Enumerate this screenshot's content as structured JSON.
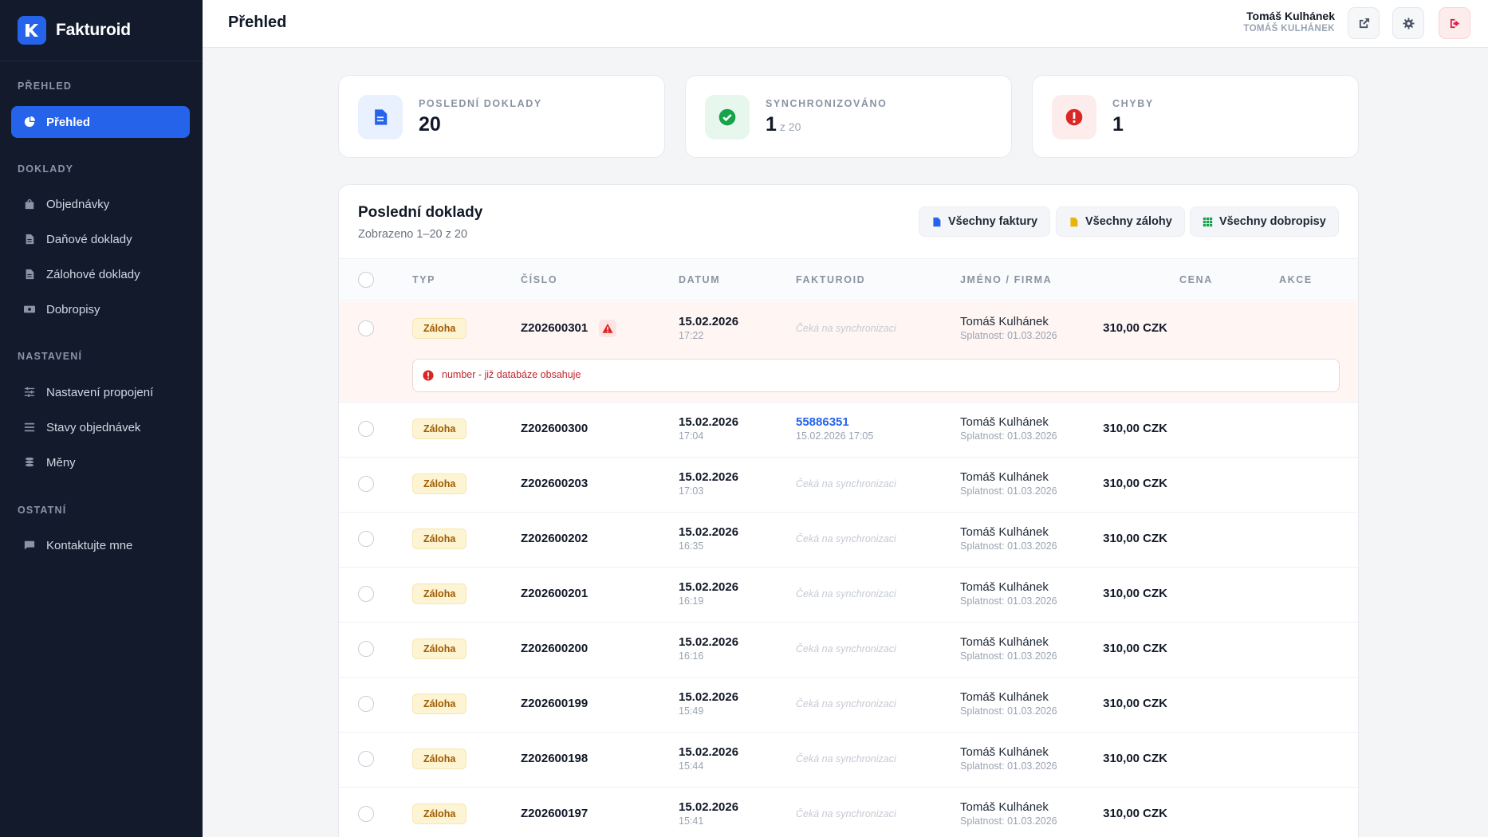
{
  "app": {
    "name": "Fakturoid"
  },
  "sidebar": {
    "sections": [
      {
        "title": "PŘEHLED",
        "items": [
          {
            "label": "Přehled",
            "icon": "pie-chart-icon",
            "active": true
          }
        ]
      },
      {
        "title": "DOKLADY",
        "items": [
          {
            "label": "Objednávky",
            "icon": "shopping-bag-icon"
          },
          {
            "label": "Daňové doklady",
            "icon": "document-icon"
          },
          {
            "label": "Zálohové doklady",
            "icon": "document-icon"
          },
          {
            "label": "Dobropisy",
            "icon": "money-bill-icon"
          }
        ]
      },
      {
        "title": "NASTAVENÍ",
        "items": [
          {
            "label": "Nastavení propojení",
            "icon": "sliders-icon"
          },
          {
            "label": "Stavy objednávek",
            "icon": "list-icon"
          },
          {
            "label": "Měny",
            "icon": "coins-icon"
          }
        ]
      },
      {
        "title": "OSTATNÍ",
        "items": [
          {
            "label": "Kontaktujte mne",
            "icon": "message-icon"
          }
        ]
      }
    ]
  },
  "header": {
    "title": "Přehled",
    "user_name": "Tomáš Kulhánek",
    "user_sub": "TOMÁŠ KULHÁNEK"
  },
  "stats": [
    {
      "label": "POSLEDNÍ DOKLADY",
      "value": "20",
      "sub": "",
      "icon": "document-icon",
      "color": "#2563eb"
    },
    {
      "label": "SYNCHRONIZOVÁNO",
      "value": "1",
      "sub": "z 20",
      "icon": "check-circle-icon",
      "color": "#16a34a"
    },
    {
      "label": "CHYBY",
      "value": "1",
      "sub": "",
      "icon": "alert-circle-icon",
      "color": "#dc2626"
    }
  ],
  "panel": {
    "title": "Poslední doklady",
    "subtitle": "Zobrazeno 1–20 z 20",
    "buttons": {
      "invoices": "Všechny faktury",
      "deposits": "Všechny zálohy",
      "credit_notes": "Všechny dobropisy"
    },
    "columns": {
      "type": "TYP",
      "number": "ČÍSLO",
      "date": "DATUM",
      "fakturoid": "FAKTUROID",
      "name": "JMÉNO / FIRMA",
      "price": "CENA",
      "actions": "AKCE"
    },
    "rows": [
      {
        "type": "Záloha",
        "number": "Z202600301",
        "date": "15.02.2026",
        "time": "17:22",
        "fakturoid": "",
        "fakturoid_sub": "",
        "pending": "Čeká na synchronizaci",
        "name": "Tomáš Kulhánek",
        "due": "Splatnost: 01.03.2026",
        "price": "310,00 CZK",
        "error": "number - již databáze obsahuje"
      },
      {
        "type": "Záloha",
        "number": "Z202600300",
        "date": "15.02.2026",
        "time": "17:04",
        "fakturoid": "55886351",
        "fakturoid_sub": "15.02.2026 17:05",
        "pending": "",
        "name": "Tomáš Kulhánek",
        "due": "Splatnost: 01.03.2026",
        "price": "310,00 CZK",
        "error": ""
      },
      {
        "type": "Záloha",
        "number": "Z202600203",
        "date": "15.02.2026",
        "time": "17:03",
        "fakturoid": "",
        "fakturoid_sub": "",
        "pending": "Čeká na synchronizaci",
        "name": "Tomáš Kulhánek",
        "due": "Splatnost: 01.03.2026",
        "price": "310,00 CZK",
        "error": ""
      },
      {
        "type": "Záloha",
        "number": "Z202600202",
        "date": "15.02.2026",
        "time": "16:35",
        "fakturoid": "",
        "fakturoid_sub": "",
        "pending": "Čeká na synchronizaci",
        "name": "Tomáš Kulhánek",
        "due": "Splatnost: 01.03.2026",
        "price": "310,00 CZK",
        "error": ""
      },
      {
        "type": "Záloha",
        "number": "Z202600201",
        "date": "15.02.2026",
        "time": "16:19",
        "fakturoid": "",
        "fakturoid_sub": "",
        "pending": "Čeká na synchronizaci",
        "name": "Tomáš Kulhánek",
        "due": "Splatnost: 01.03.2026",
        "price": "310,00 CZK",
        "error": ""
      },
      {
        "type": "Záloha",
        "number": "Z202600200",
        "date": "15.02.2026",
        "time": "16:16",
        "fakturoid": "",
        "fakturoid_sub": "",
        "pending": "Čeká na synchronizaci",
        "name": "Tomáš Kulhánek",
        "due": "Splatnost: 01.03.2026",
        "price": "310,00 CZK",
        "error": ""
      },
      {
        "type": "Záloha",
        "number": "Z202600199",
        "date": "15.02.2026",
        "time": "15:49",
        "fakturoid": "",
        "fakturoid_sub": "",
        "pending": "Čeká na synchronizaci",
        "name": "Tomáš Kulhánek",
        "due": "Splatnost: 01.03.2026",
        "price": "310,00 CZK",
        "error": ""
      },
      {
        "type": "Záloha",
        "number": "Z202600198",
        "date": "15.02.2026",
        "time": "15:44",
        "fakturoid": "",
        "fakturoid_sub": "",
        "pending": "Čeká na synchronizaci",
        "name": "Tomáš Kulhánek",
        "due": "Splatnost: 01.03.2026",
        "price": "310,00 CZK",
        "error": ""
      },
      {
        "type": "Záloha",
        "number": "Z202600197",
        "date": "15.02.2026",
        "time": "15:41",
        "fakturoid": "",
        "fakturoid_sub": "",
        "pending": "Čeká na synchronizaci",
        "name": "Tomáš Kulhánek",
        "due": "Splatnost: 01.03.2026",
        "price": "310,00 CZK",
        "error": ""
      }
    ]
  }
}
